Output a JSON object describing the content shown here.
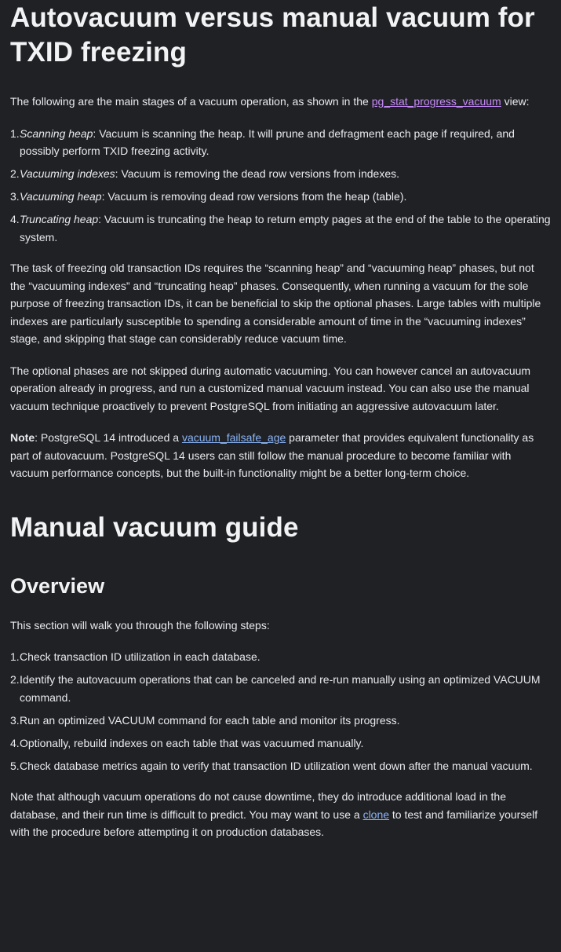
{
  "section1": {
    "title": "Autovacuum versus manual vacuum for TXID freezing",
    "intro_prefix": "The following are the main stages  of a vacuum operation, as shown in the ",
    "intro_link": "pg_stat_progress_vacuum",
    "intro_suffix": " view:",
    "stages": [
      {
        "num": "1.",
        "term": "Scanning heap",
        "text": ": Vacuum is scanning the heap. It will prune and defragment each page if required, and possibly perform TXID freezing activity."
      },
      {
        "num": "2.",
        "term": "Vacuuming indexes",
        "text": ": Vacuum is removing the dead row versions from indexes."
      },
      {
        "num": "3.",
        "term": "Vacuuming heap",
        "text": ": Vacuum is removing dead row versions from the heap (table)."
      },
      {
        "num": "4.",
        "term": "Truncating heap",
        "text": ": Vacuum is truncating the heap to return empty pages at the end of the table to the operating system."
      }
    ],
    "para1": "The task of freezing old transaction IDs requires the “scanning heap” and “vacuuming heap” phases, but not the “vacuuming indexes” and “truncating heap” phases. Consequently, when running a vacuum for the sole purpose of freezing transaction IDs, it can be beneficial to skip the optional phases. Large tables with multiple indexes are particularly susceptible to spending a considerable amount of time in the “vacuuming indexes” stage, and skipping that stage can considerably reduce vacuum time.",
    "para2": "The optional phases are not skipped during automatic vacuuming. You can however cancel an autovacuum operation already in progress, and run a customized manual vacuum instead. You can also use the manual vacuum technique proactively to prevent PostgreSQL from initiating an aggressive autovacuum later.",
    "note_label": "Note",
    "note_prefix": ": PostgreSQL 14 introduced a ",
    "note_link": "vacuum_failsafe_age",
    "note_suffix": " parameter that provides equivalent functionality as part of autovacuum. PostgreSQL 14 users can still follow the manual procedure to become familiar with vacuum performance concepts, but the built-in functionality might be a better long-term choice."
  },
  "section2": {
    "title": "Manual vacuum guide",
    "subtitle": "Overview",
    "intro": "This section will walk you through the following steps:",
    "steps": [
      {
        "num": "1.",
        "text": "Check transaction ID utilization in each database."
      },
      {
        "num": "2.",
        "text": "Identify the autovacuum operations that can be canceled and re-run manually using an optimized VACUUM command."
      },
      {
        "num": "3.",
        "text": "Run an optimized VACUUM command for each table and monitor its progress."
      },
      {
        "num": "4.",
        "text": "Optionally, rebuild indexes on each table that was vacuumed manually."
      },
      {
        "num": "5.",
        "text": "Check database metrics again to verify that transaction ID utilization went down after the manual vacuum."
      }
    ],
    "closing_prefix": "Note that although vacuum operations do not cause downtime, they do introduce additional load in the database, and their run time is difficult to predict. You may want to use a ",
    "closing_link": "clone",
    "closing_suffix": " to test and familiarize yourself with the procedure before attempting it on production databases."
  },
  "colors": {
    "background": "#202124",
    "text": "#e8eaed",
    "link_visited": "#c58af9",
    "link": "#8ab4f8"
  }
}
